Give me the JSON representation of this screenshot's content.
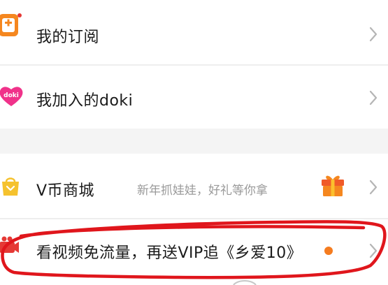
{
  "topstrip": {
    "fragment": ""
  },
  "menu": {
    "subscription": {
      "label": "我的订阅",
      "icon": "subscribe-icon"
    },
    "doki": {
      "label": "我加入的doki",
      "icon": "doki-icon",
      "icon_text": "doki"
    },
    "vcoin": {
      "label": "V币商城",
      "subtitle": "新年抓娃娃，好礼等你拿",
      "icon": "shopping-bag-icon",
      "badge_icon": "gift-icon"
    },
    "promo": {
      "label": "看视频免流量，再送VIP追《乡爱10》",
      "icon": "video-camera-icon",
      "badge": "dot"
    }
  },
  "colors": {
    "orange": "#f5871f",
    "pink": "#f0328a",
    "yellow": "#f5c22e",
    "red_marker": "#e0161c",
    "chevron": "#b5b5b5"
  }
}
